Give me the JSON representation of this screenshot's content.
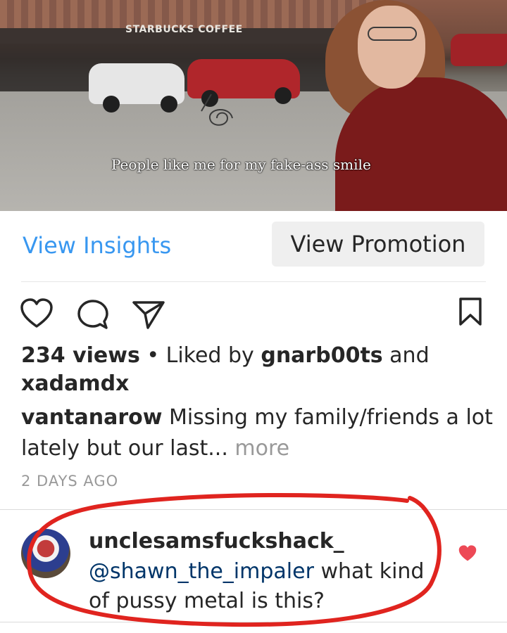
{
  "video": {
    "sign_text": "STARBUCKS COFFEE",
    "caption": "People like me for my fake-ass smile"
  },
  "buttons": {
    "view_insights": "View Insights",
    "view_promotion": "View Promotion"
  },
  "icons": {
    "like": "heart-icon",
    "comment": "comment-bubble-icon",
    "share": "paper-plane-icon",
    "save": "bookmark-icon",
    "comment_like": "heart-filled-icon"
  },
  "post": {
    "views": "234 views",
    "separator": " • ",
    "liked_by_prefix": "Liked by ",
    "liker1": "gnarb00ts",
    "and": " and",
    "liker2": "xadamdx",
    "author": "vantanarow",
    "caption": "Missing my family/friends a lot lately but our last...",
    "more": " more",
    "time": "2 DAYS AGO"
  },
  "comment": {
    "username": "unclesamsfuckshack_",
    "mention": "@shawn_the_impaler",
    "text": " what kind of pussy metal is this?"
  },
  "colors": {
    "link_blue": "#3897f0",
    "mention_blue": "#003569",
    "heart_red": "#ed4956",
    "annotation_red": "#e0241f"
  }
}
